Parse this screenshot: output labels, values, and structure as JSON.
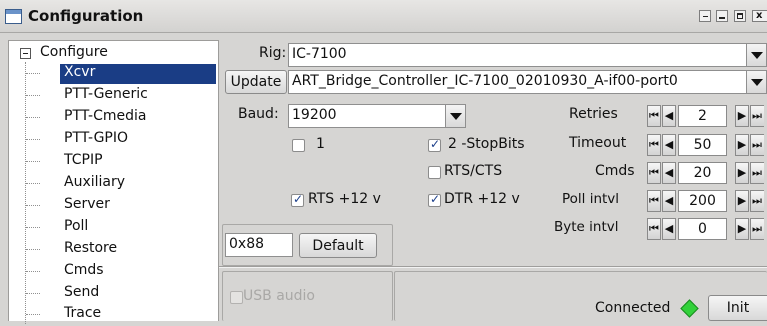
{
  "window": {
    "title": "Configuration",
    "app_icon": "config-window-icon",
    "controls": [
      "minimize",
      "restore",
      "maximize",
      "close"
    ]
  },
  "tree": {
    "root": "Configure",
    "items": [
      {
        "label": "Xcvr",
        "selected": true
      },
      {
        "label": "PTT-Generic"
      },
      {
        "label": "PTT-Cmedia"
      },
      {
        "label": "PTT-GPIO"
      },
      {
        "label": "TCPIP"
      },
      {
        "label": "Auxiliary"
      },
      {
        "label": "Server"
      },
      {
        "label": "Poll"
      },
      {
        "label": "Restore"
      },
      {
        "label": "Cmds"
      },
      {
        "label": "Send"
      },
      {
        "label": "Trace"
      }
    ]
  },
  "xcvr": {
    "rig_label": "Rig:",
    "rig_value": "IC-7100",
    "update_button": "Update",
    "file_value": "ART_Bridge_Controller_IC-7100_02010930_A-if00-port0",
    "baud_label": "Baud:",
    "baud_value": "19200",
    "check_1": {
      "label": "1",
      "checked": false
    },
    "check_stopbits": {
      "label": "2 -StopBits",
      "checked": true
    },
    "check_rtscts": {
      "label": "RTS/CTS",
      "checked": false
    },
    "check_rts12": {
      "label": "RTS +12 v",
      "checked": true
    },
    "check_dtr12": {
      "label": "DTR +12 v",
      "checked": true
    },
    "civ_value": "0x88",
    "default_button": "Default",
    "spinners": [
      {
        "label": "Retries",
        "value": "2"
      },
      {
        "label": "Timeout",
        "value": "50"
      },
      {
        "label": "Cmds",
        "value": "20"
      },
      {
        "label": "Poll intvl",
        "value": "200"
      },
      {
        "label": "Byte intvl",
        "value": "0"
      }
    ],
    "usb_audio": {
      "label": "USB audio",
      "checked": false,
      "enabled": false
    },
    "connected_label": "Connected",
    "connected_color": "#32d13a",
    "init_button": "Init"
  }
}
